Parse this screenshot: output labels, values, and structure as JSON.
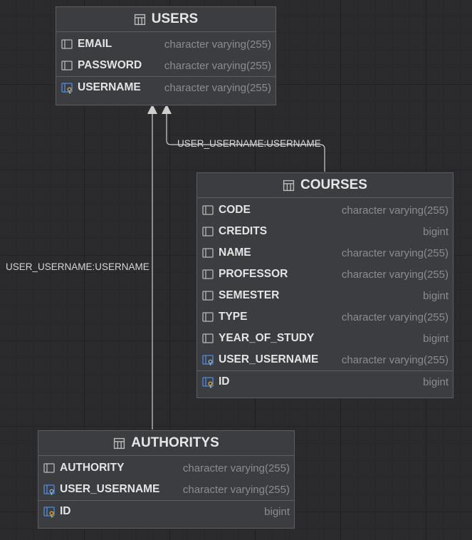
{
  "colors": {
    "background": "#2b2b2d",
    "table_background": "#3c3d40",
    "table_border": "#5d5e62",
    "connector": "#cfcfcf",
    "key_blue": "#4a90e2",
    "key_gold": "#d4a33a"
  },
  "edges": [
    {
      "label": "USER_USERNAME:USERNAME",
      "from": "COURSES",
      "to": "USERS"
    },
    {
      "label": "USER_USERNAME:USERNAME",
      "from": "AUTHORITYS",
      "to": "USERS"
    }
  ],
  "tables": {
    "users": {
      "name": "USERS",
      "columns": [
        {
          "name": "EMAIL",
          "type": "character varying(255)",
          "icon": "column-icon"
        },
        {
          "name": "PASSWORD",
          "type": "character varying(255)",
          "icon": "column-icon"
        }
      ],
      "keys": [
        {
          "name": "USERNAME",
          "type": "character varying(255)",
          "icon": "primary-key-icon"
        }
      ]
    },
    "courses": {
      "name": "COURSES",
      "columns": [
        {
          "name": "CODE",
          "type": "character varying(255)",
          "icon": "column-icon"
        },
        {
          "name": "CREDITS",
          "type": "bigint",
          "icon": "column-icon"
        },
        {
          "name": "NAME",
          "type": "character varying(255)",
          "icon": "column-icon"
        },
        {
          "name": "PROFESSOR",
          "type": "character varying(255)",
          "icon": "column-icon"
        },
        {
          "name": "SEMESTER",
          "type": "bigint",
          "icon": "column-icon"
        },
        {
          "name": "TYPE",
          "type": "character varying(255)",
          "icon": "column-icon"
        },
        {
          "name": "YEAR_OF_STUDY",
          "type": "bigint",
          "icon": "column-icon"
        },
        {
          "name": "USER_USERNAME",
          "type": "character varying(255)",
          "icon": "foreign-key-icon"
        }
      ],
      "keys": [
        {
          "name": "ID",
          "type": "bigint",
          "icon": "primary-key-icon"
        }
      ]
    },
    "authoritys": {
      "name": "AUTHORITYS",
      "columns": [
        {
          "name": "AUTHORITY",
          "type": "character varying(255)",
          "icon": "column-icon"
        },
        {
          "name": "USER_USERNAME",
          "type": "character varying(255)",
          "icon": "foreign-key-icon"
        }
      ],
      "keys": [
        {
          "name": "ID",
          "type": "bigint",
          "icon": "primary-key-icon"
        }
      ]
    }
  }
}
